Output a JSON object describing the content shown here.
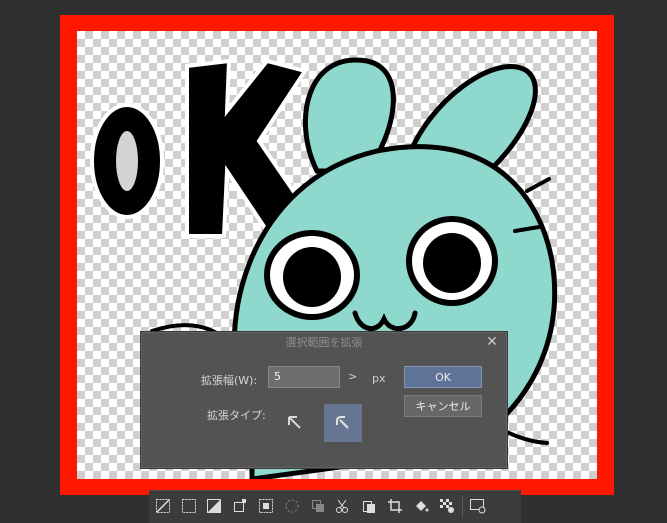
{
  "dialog": {
    "title": "選択範囲を拡張",
    "expand_width_label": "拡張幅(W):",
    "expand_width_value": "5",
    "unit_chevron": ">",
    "unit": "px",
    "expand_type_label": "拡張タイプ:",
    "ok_label": "OK",
    "cancel_label": "キャンセル",
    "close_glyph": "✕"
  },
  "toolbar": {
    "tools": [
      "deselect-icon",
      "invert-selection-icon",
      "fill-selection-icon",
      "transform-selection-icon",
      "select-layer-icon",
      "shrink-selection-icon",
      "copy-selection-icon",
      "cut-paste-icon",
      "paste-icon",
      "crop-icon",
      "fill-icon",
      "clear-outside-icon",
      "selection-settings-icon"
    ]
  },
  "colors": {
    "frame_red": "#ff1800",
    "bunny": "#8fd8cd",
    "ok_button": "#5f7398",
    "selected_type": "#667592"
  }
}
